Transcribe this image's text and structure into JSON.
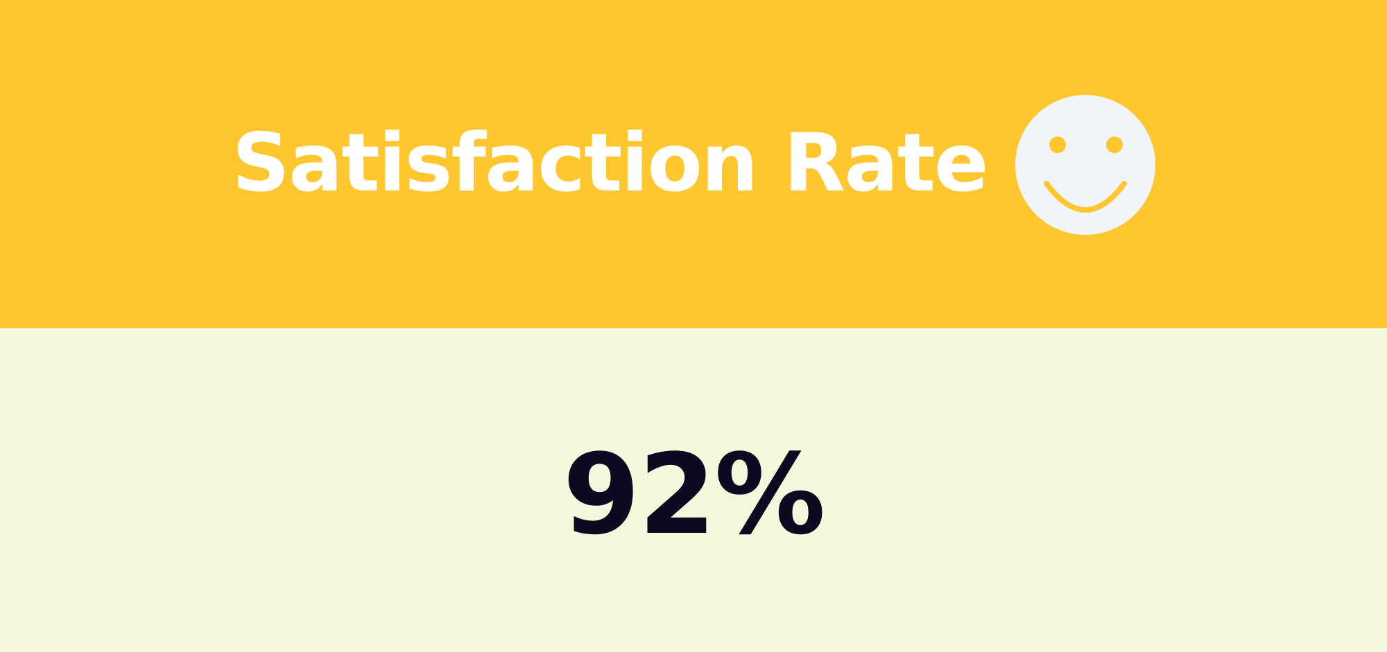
{
  "header": {
    "title": "Satisfaction Rate",
    "icon": "smiley-face-icon"
  },
  "metric": {
    "value": "92%",
    "fraction": 0.92
  },
  "colors": {
    "header_background": "#FFC62E",
    "body_background": "#F3F9DD",
    "title_text": "#FFFFFF",
    "value_text": "#0E0820",
    "icon_fill": "#F1F4F9",
    "icon_features": "#FFC62E"
  }
}
